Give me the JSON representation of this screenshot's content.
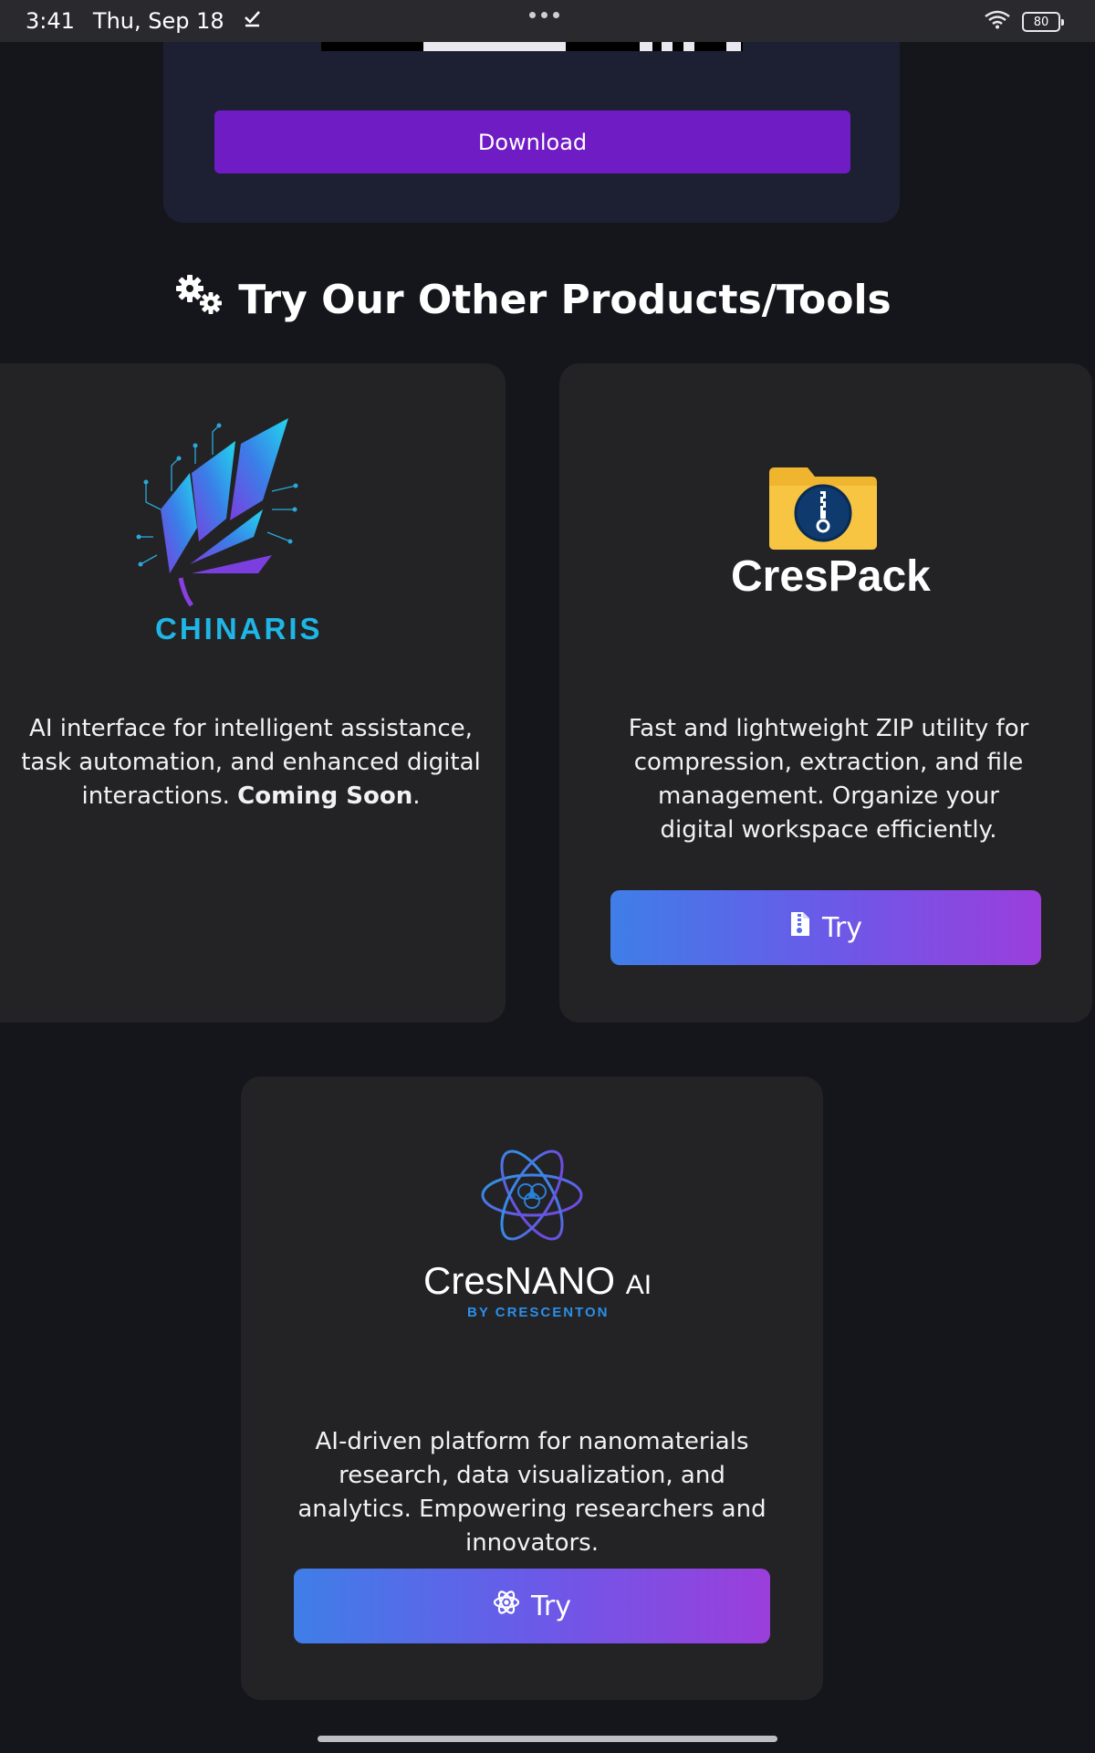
{
  "status_bar": {
    "time": "3:41",
    "date": "Thu, Sep 18",
    "battery": "80",
    "icons": [
      "check-icon",
      "wifi-icon",
      "battery-icon"
    ]
  },
  "top_card": {
    "download_label": "Download"
  },
  "section": {
    "title": "Try Our Other Products/Tools",
    "icon": "gears-icon"
  },
  "products": {
    "chinaris": {
      "logo_text": "CHINARIS",
      "desc_pre": "AI interface for intelligent assistance, task automation, and enhanced digital interactions. ",
      "desc_bold": "Coming Soon",
      "desc_post": "."
    },
    "crespack": {
      "logo_text": "CresPack",
      "desc": "Fast and lightweight ZIP utility for compression, extraction, and file management. Organize your digital workspace efficiently.",
      "try_label": "Try",
      "try_icon": "zip-file-icon"
    },
    "cresnano": {
      "logo_name": "CresNANO",
      "logo_ai": "AI",
      "logo_by": "BY CRESCENTON",
      "desc": "AI-driven platform for nanomaterials research, data visualization, and analytics. Empowering researchers and innovators.",
      "try_label": "Try",
      "try_icon": "atom-icon"
    }
  },
  "colors": {
    "background": "#15151c",
    "card": "#232325",
    "top_card": "#1d2033",
    "download": "#6f1cc4",
    "gradient_start": "#3f7ee8",
    "gradient_end": "#9b3edc",
    "chinaris_text": "#1fb6e6"
  }
}
